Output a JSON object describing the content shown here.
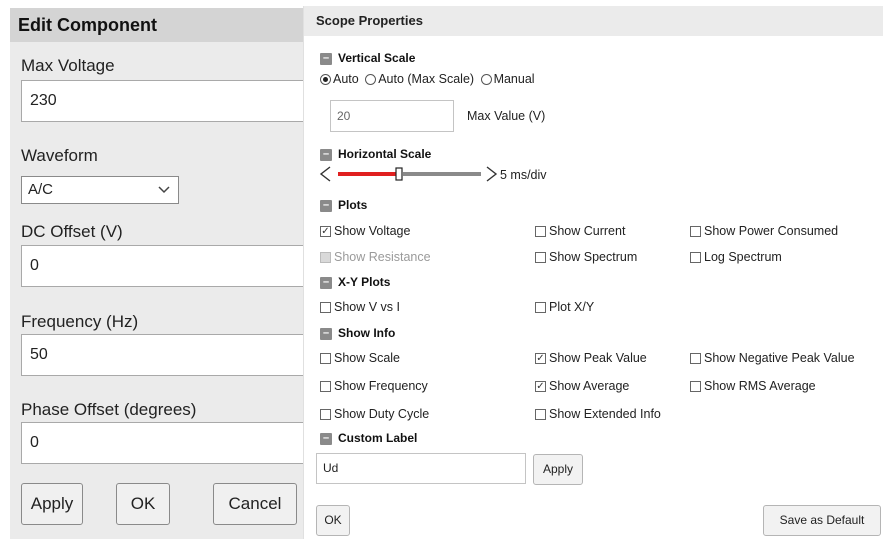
{
  "edit_component": {
    "title": "Edit Component",
    "max_voltage_label": "Max Voltage",
    "max_voltage_value": "230",
    "waveform_label": "Waveform",
    "waveform_value": "A/C",
    "dc_offset_label": "DC Offset (V)",
    "dc_offset_value": "0",
    "frequency_label": "Frequency (Hz)",
    "frequency_value": "50",
    "phase_offset_label": "Phase Offset (degrees)",
    "phase_offset_value": "0",
    "apply_label": "Apply",
    "ok_label": "OK",
    "cancel_label": "Cancel"
  },
  "scope": {
    "title": "Scope Properties",
    "vertical_scale": {
      "header": "Vertical Scale",
      "radio_auto": "Auto",
      "radio_auto_max": "Auto (Max Scale)",
      "radio_manual": "Manual",
      "selected": "Auto",
      "max_value_input": "20",
      "max_value_label": "Max Value (V)"
    },
    "horizontal_scale": {
      "header": "Horizontal Scale",
      "left_arrow": "<",
      "right_arrow": ">",
      "value_text": "5 ms/div",
      "slider_position": 0.4
    },
    "plots": {
      "header": "Plots",
      "show_voltage": "Show Voltage",
      "show_current": "Show Current",
      "show_power": "Show Power Consumed",
      "show_resistance": "Show Resistance",
      "show_spectrum": "Show Spectrum",
      "log_spectrum": "Log Spectrum"
    },
    "xy_plots": {
      "header": "X-Y Plots",
      "show_v_vs_i": "Show V vs I",
      "plot_xy": "Plot X/Y"
    },
    "show_info": {
      "header": "Show Info",
      "show_scale": "Show Scale",
      "show_peak": "Show Peak Value",
      "show_neg_peak": "Show Negative Peak Value",
      "show_frequency": "Show Frequency",
      "show_average": "Show Average",
      "show_rms": "Show RMS Average",
      "show_duty": "Show Duty Cycle",
      "show_extended": "Show Extended Info"
    },
    "custom_label": {
      "header": "Custom Label",
      "value": "Ud",
      "apply_label": "Apply"
    },
    "ok_label": "OK",
    "save_default_label": "Save as Default",
    "check_mark": "✓",
    "colors": {
      "slider_active": "#e02020",
      "slider_inactive": "#8a8a8a"
    }
  }
}
